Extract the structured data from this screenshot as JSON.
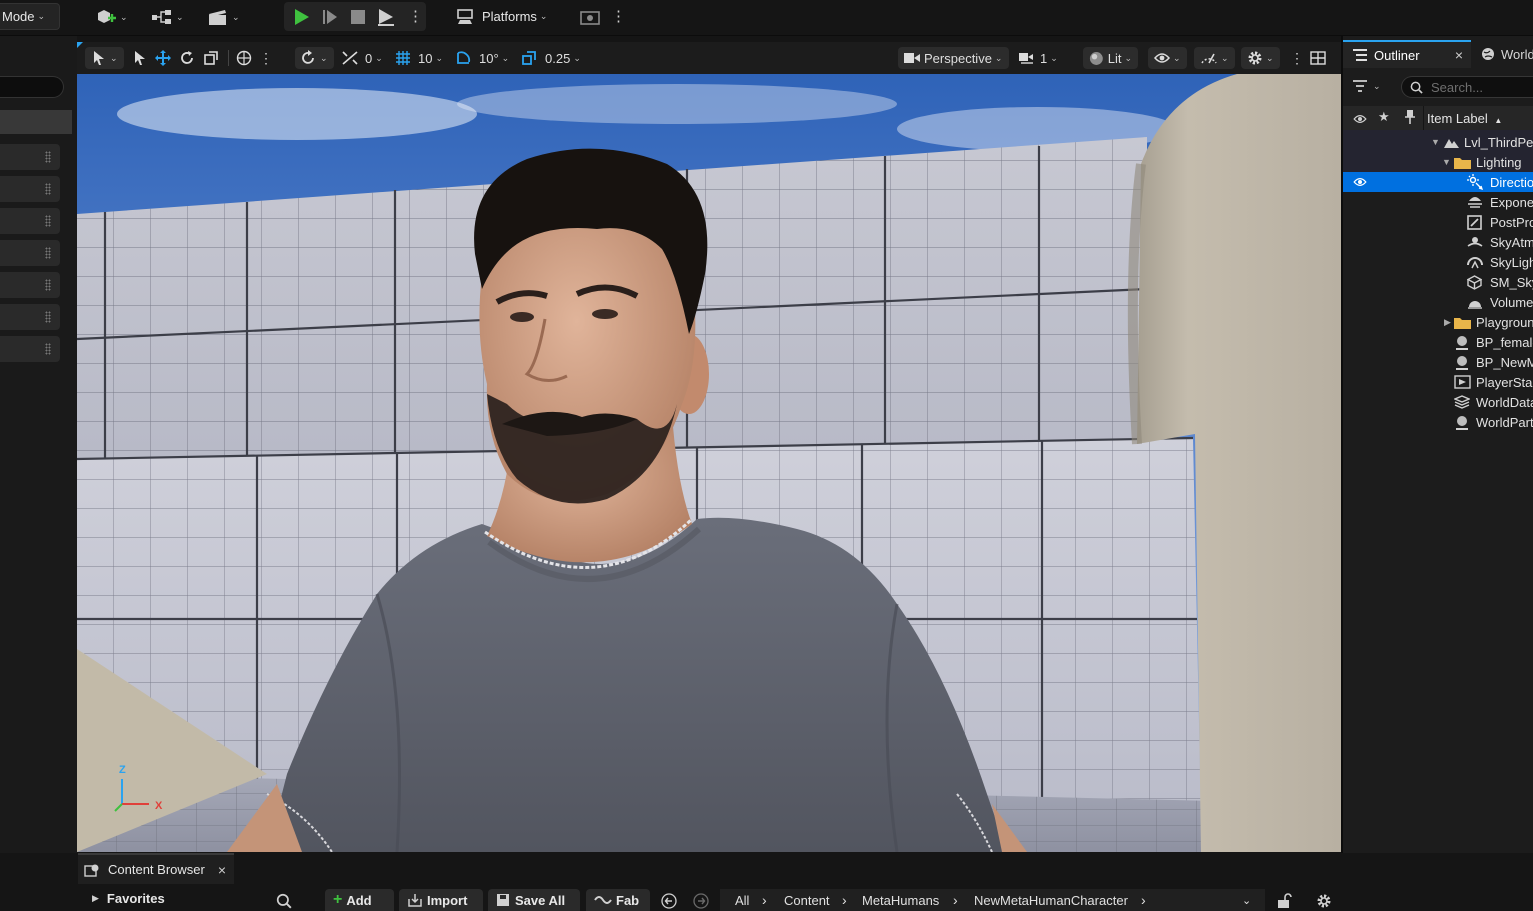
{
  "toolbar": {
    "mode_label": "Mode",
    "platforms_label": "Platforms"
  },
  "viewport": {
    "translate_snap": "0",
    "grid_snap": "10",
    "rotate_snap": "10°",
    "scale_snap": "0.25",
    "camera_label": "Perspective",
    "camera_speed": "1",
    "view_mode_label": "Lit",
    "axis_z": "Z",
    "axis_x": "X"
  },
  "outliner": {
    "tab_label": "Outliner",
    "world_tab_label": "World",
    "search_placeholder": "Search...",
    "column_label": "Item Label",
    "items": [
      {
        "label": "Lvl_ThirdPe",
        "icon": "level-icon"
      },
      {
        "label": "Lighting",
        "icon": "folder-icon"
      },
      {
        "label": "Directio",
        "icon": "directional-light-icon"
      },
      {
        "label": "Exponer",
        "icon": "fog-icon"
      },
      {
        "label": "PostPro",
        "icon": "postprocess-icon"
      },
      {
        "label": "SkyAtm",
        "icon": "sky-atmosphere-icon"
      },
      {
        "label": "SkyLigh",
        "icon": "skylight-icon"
      },
      {
        "label": "SM_Sky",
        "icon": "static-mesh-icon"
      },
      {
        "label": "Volumet",
        "icon": "volumetric-cloud-icon"
      },
      {
        "label": "Playgroun",
        "icon": "folder-icon"
      },
      {
        "label": "BP_female",
        "icon": "blueprint-actor-icon"
      },
      {
        "label": "BP_NewM",
        "icon": "blueprint-actor-icon"
      },
      {
        "label": "PlayerSta",
        "icon": "player-start-icon"
      },
      {
        "label": "WorldData",
        "icon": "world-data-icon"
      },
      {
        "label": "WorldPart",
        "icon": "world-partition-icon"
      }
    ]
  },
  "content_browser": {
    "tab_label": "Content Browser",
    "favorites_label": "Favorites",
    "add_label": "Add",
    "import_label": "Import",
    "save_all_label": "Save All",
    "fab_label": "Fab",
    "breadcrumb": [
      "All",
      "Content",
      "MetaHumans",
      "NewMetaHumanCharacter"
    ]
  },
  "colors": {
    "selection": "#0070e0",
    "play_green": "#3fc13f",
    "accent_blue": "#2aa3f0"
  }
}
